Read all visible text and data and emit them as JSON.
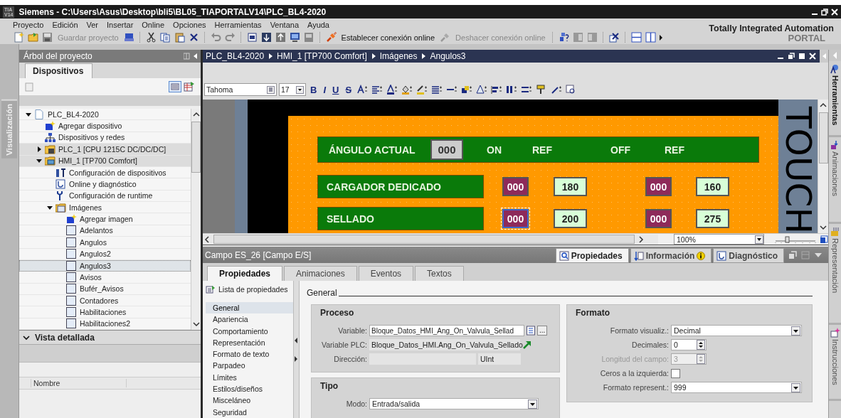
{
  "window": {
    "logo": [
      "TIA",
      "V14"
    ],
    "title": "Siemens - C:\\Users\\Asus\\Desktop\\bli5\\BL05_TIAPORTALV14\\PLC_BL4-2020"
  },
  "menu": [
    "Proyecto",
    "Edición",
    "Ver",
    "Insertar",
    "Online",
    "Opciones",
    "Herramientas",
    "Ventana",
    "Ayuda"
  ],
  "toolbar": {
    "save": {
      "label": "Guardar proyecto",
      "disabled": true
    },
    "connect": {
      "label": "Establecer conexión online",
      "disabled": false
    },
    "disconnect": {
      "label": "Deshacer conexión online",
      "disabled": true
    }
  },
  "brand": {
    "line1": "Totally Integrated Automation",
    "line2": "PORTAL"
  },
  "left_strip": {
    "label": "Visualización"
  },
  "project_tree": {
    "title": "Árbol del proyecto",
    "tab": "Dispositivos",
    "items": [
      {
        "label": "PLC_BL4-2020",
        "kind": "project",
        "expanded": true,
        "selected": false,
        "children": [
          {
            "label": "Agregar dispositivo",
            "kind": "add",
            "selected": false
          },
          {
            "label": "Dispositivos y redes",
            "kind": "network",
            "selected": false
          },
          {
            "label": "PLC_1 [CPU 1215C DC/DC/DC]",
            "kind": "plc",
            "expanded": false,
            "selected": false
          },
          {
            "label": "HMI_1 [TP700 Comfort]",
            "kind": "hmi",
            "expanded": true,
            "selected": false,
            "children": [
              {
                "label": "Configuración de dispositivos",
                "kind": "config",
                "selected": false
              },
              {
                "label": "Online y diagnóstico",
                "kind": "diagnostics",
                "selected": false
              },
              {
                "label": "Configuración de runtime",
                "kind": "runtime",
                "selected": false
              },
              {
                "label": "Imágenes",
                "kind": "folder",
                "expanded": true,
                "selected": false,
                "children": [
                  {
                    "label": "Agregar imagen",
                    "kind": "add",
                    "selected": false
                  },
                  {
                    "label": "Adelantos",
                    "kind": "screen",
                    "selected": false
                  },
                  {
                    "label": "Angulos",
                    "kind": "screen",
                    "selected": false
                  },
                  {
                    "label": "Angulos2",
                    "kind": "screen",
                    "selected": false
                  },
                  {
                    "label": "Angulos3",
                    "kind": "screen",
                    "selected": true
                  },
                  {
                    "label": "Avisos",
                    "kind": "screen",
                    "selected": false
                  },
                  {
                    "label": "Bufér_Avisos",
                    "kind": "screen",
                    "selected": false
                  },
                  {
                    "label": "Contadores",
                    "kind": "screen",
                    "selected": false
                  },
                  {
                    "label": "Habilitaciones",
                    "kind": "screen",
                    "selected": false
                  },
                  {
                    "label": "Habilitaciones2",
                    "kind": "screen",
                    "selected": false
                  }
                ]
              }
            ]
          }
        ]
      }
    ],
    "detail": {
      "title": "Vista detallada",
      "expanded": true,
      "column": "Nombre"
    }
  },
  "editor": {
    "breadcrumb": [
      "PLC_BL4-2020",
      "HMI_1 [TP700 Comfort]",
      "Imágenes",
      "Angulos3"
    ],
    "font": "Tahoma",
    "font_size": "17",
    "format_buttons": [
      "B",
      "I",
      "U",
      "S"
    ],
    "zoom": "100%",
    "hmi": {
      "header": {
        "title": "ÁNGULO ACTUAL",
        "value": "000",
        "labels": [
          "ON",
          "REF",
          "OFF",
          "REF"
        ]
      },
      "rows": [
        {
          "label": "CARGADOR DEDICADO",
          "fields": [
            {
              "text": "000",
              "kind": "value",
              "selected": false
            },
            {
              "text": "180",
              "kind": "ref",
              "selected": false
            },
            {
              "text": "000",
              "kind": "value",
              "selected": false
            },
            {
              "text": "160",
              "kind": "ref",
              "selected": false
            }
          ]
        },
        {
          "label": "SELLADO",
          "fields": [
            {
              "text": "000",
              "kind": "value",
              "selected": true
            },
            {
              "text": "200",
              "kind": "ref",
              "selected": false
            },
            {
              "text": "000",
              "kind": "value",
              "selected": false
            },
            {
              "text": "275",
              "kind": "ref",
              "selected": false
            }
          ]
        }
      ],
      "side_text": "TOUCH"
    }
  },
  "inspector": {
    "title": "Campo ES_26 [Campo E/S]",
    "views": [
      {
        "label": "Propiedades",
        "selected": true
      },
      {
        "label": "Información",
        "selected": false
      },
      {
        "label": "Diagnóstico",
        "selected": false
      }
    ],
    "tabs": [
      {
        "label": "Propiedades",
        "selected": true
      },
      {
        "label": "Animaciones",
        "selected": false
      },
      {
        "label": "Eventos",
        "selected": false
      },
      {
        "label": "Textos",
        "selected": false
      }
    ],
    "list_title": "Lista de propiedades",
    "sections": [
      {
        "label": "General",
        "selected": true
      },
      {
        "label": "Apariencia",
        "selected": false
      },
      {
        "label": "Comportamiento",
        "selected": false
      },
      {
        "label": "Representación",
        "selected": false
      },
      {
        "label": "Formato de texto",
        "selected": false
      },
      {
        "label": "Parpadeo",
        "selected": false
      },
      {
        "label": "Límites",
        "selected": false
      },
      {
        "label": "Estilos/diseños",
        "selected": false
      },
      {
        "label": "Misceláneo",
        "selected": false
      },
      {
        "label": "Seguridad",
        "selected": false
      }
    ],
    "heading": "General",
    "proceso": {
      "title": "Proceso",
      "variable_label": "Variable:",
      "variable": "Bloque_Datos_HMI_Ang_On_Valvula_Sellad",
      "browse": "...",
      "plc_label": "Variable PLC:",
      "plc": "Bloque_Datos_HMI.Ang_On_Valvula_Sellado",
      "address_label": "Dirección:",
      "type": "UInt"
    },
    "tipo": {
      "title": "Tipo",
      "mode_label": "Modo:",
      "mode": "Entrada/salida"
    },
    "formato": {
      "title": "Formato",
      "fields": [
        {
          "kind": "dropdown",
          "label": "Formato visualiz.:",
          "value": "Decimal",
          "disabled": false
        },
        {
          "kind": "spin",
          "label": "Decimales:",
          "value": "0",
          "disabled": false
        },
        {
          "kind": "spin",
          "label": "Longitud del campo:",
          "value": "3",
          "disabled": true
        },
        {
          "kind": "checkbox",
          "label": "Ceros a la izquierda:",
          "checked": false,
          "disabled": false
        },
        {
          "kind": "dropdown",
          "label": "Formato represent.:",
          "value": "999",
          "disabled": false
        }
      ]
    }
  },
  "right_strip": [
    {
      "label": "Herramientas",
      "selected": true
    },
    {
      "label": "Animaciones",
      "selected": false
    },
    {
      "label": "Representación",
      "selected": false
    },
    {
      "label": "Instrucciones",
      "selected": false
    }
  ]
}
